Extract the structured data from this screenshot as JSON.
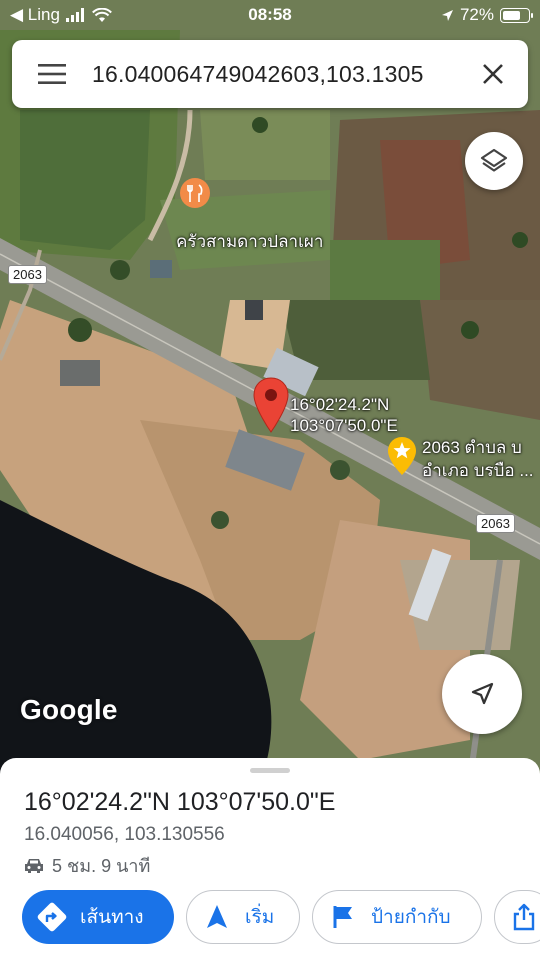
{
  "status_bar": {
    "back_app": "◀ Ling",
    "time": "08:58",
    "battery_percent": "72%",
    "battery_level": 0.72
  },
  "search": {
    "query": "16.040064749042603,103.1305"
  },
  "map": {
    "restaurant_name": "ครัวสามดาวปลาเผา",
    "route_number_1": "2063",
    "route_number_2": "2063",
    "pin_lat": "16°02'24.2\"N",
    "pin_lng": "103°07'50.0\"E",
    "place_line1": "2063 ตำบล บ",
    "place_line2": "อำเภอ บรบือ ...",
    "logo": "Google"
  },
  "sheet": {
    "title": "16°02'24.2\"N 103°07'50.0\"E",
    "coords": "16.040056, 103.130556",
    "drive_time": "5 ชม. 9 นาที",
    "directions_label": "เส้นทาง",
    "start_label": "เริ่ม",
    "label_label": "ป้ายกำกับ"
  },
  "colors": {
    "accent": "#1a73e8",
    "pin_red": "#ea4335",
    "star_yellow": "#fbbc04",
    "restaurant_orange": "#f28b48"
  },
  "icons": [
    "menu-icon",
    "close-icon",
    "layers-icon",
    "locate-icon",
    "restaurant-icon",
    "map-pin-icon",
    "star-icon",
    "car-icon",
    "directions-icon",
    "navigation-icon",
    "flag-icon",
    "share-icon"
  ]
}
